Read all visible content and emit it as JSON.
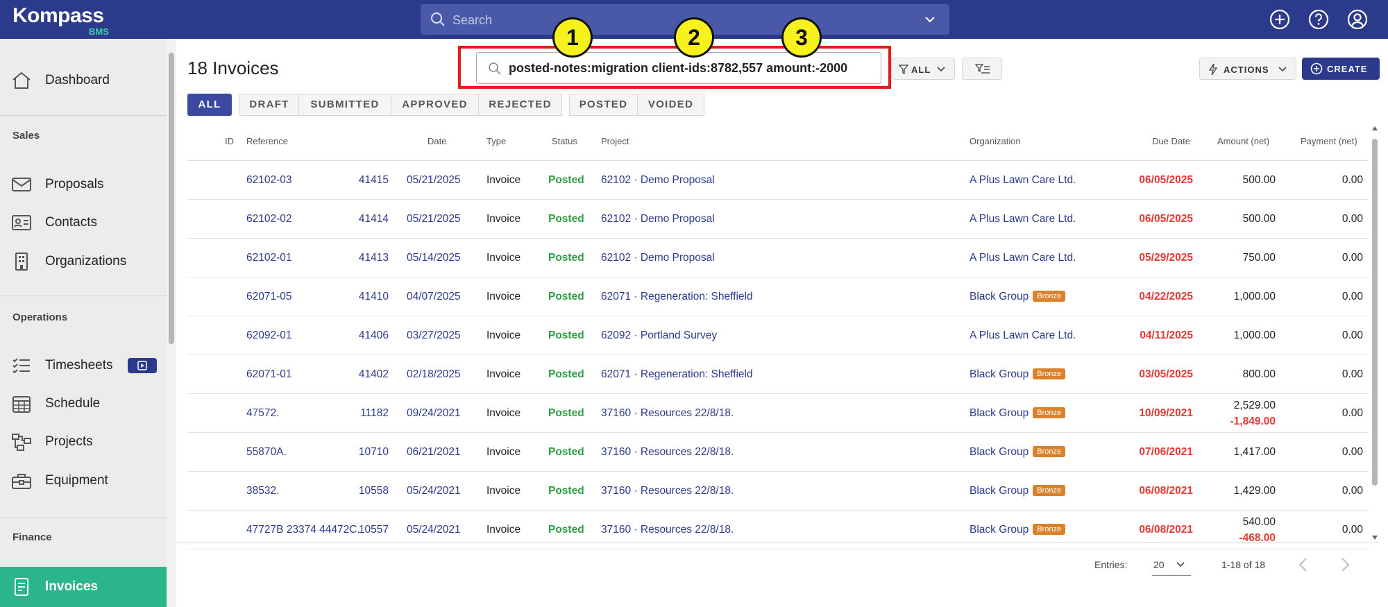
{
  "app": {
    "logo_name": "Kompass",
    "logo_sub": "BMS"
  },
  "topbar": {
    "search_placeholder": "Search"
  },
  "sidebar": {
    "items": [
      {
        "label": "Dashboard",
        "icon": "home-icon"
      },
      {
        "section": "Sales"
      },
      {
        "label": "Proposals",
        "icon": "envelope-icon"
      },
      {
        "label": "Contacts",
        "icon": "contact-card-icon"
      },
      {
        "label": "Organizations",
        "icon": "building-icon"
      },
      {
        "section": "Operations"
      },
      {
        "label": "Timesheets",
        "icon": "checklist-icon"
      },
      {
        "label": "Schedule",
        "icon": "calendar-icon"
      },
      {
        "label": "Projects",
        "icon": "project-tree-icon"
      },
      {
        "label": "Equipment",
        "icon": "toolbox-icon"
      },
      {
        "section": "Finance"
      },
      {
        "label": "Invoices",
        "icon": "invoice-icon",
        "active": true
      }
    ],
    "labels": {
      "dashboard": "Dashboard",
      "sales": "Sales",
      "proposals": "Proposals",
      "contacts": "Contacts",
      "organizations": "Organizations",
      "operations": "Operations",
      "timesheets": "Timesheets",
      "schedule": "Schedule",
      "projects": "Projects",
      "equipment": "Equipment",
      "finance": "Finance",
      "invoices": "Invoices"
    }
  },
  "main": {
    "title": "18 Invoices",
    "query": "posted-notes:migration client-ids:8782,557 amount:-2000",
    "markers": [
      "1",
      "2",
      "3"
    ],
    "filter_all": "ALL",
    "actions": "ACTIONS",
    "create": "CREATE",
    "tabs": [
      "ALL",
      "DRAFT",
      "SUBMITTED",
      "APPROVED",
      "REJECTED",
      "POSTED",
      "VOIDED"
    ]
  },
  "table": {
    "headers": {
      "id": "ID",
      "reference": "Reference",
      "date": "Date",
      "type": "Type",
      "status": "Status",
      "project": "Project",
      "organization": "Organization",
      "due": "Due Date",
      "amount": "Amount (net)",
      "payment": "Payment (net)"
    },
    "rows": [
      {
        "id": "41415",
        "ref": "62102-03",
        "date": "05/21/2025",
        "type": "Invoice",
        "status": "Posted",
        "project": "62102 · Demo Proposal",
        "org": "A Plus Lawn Care Ltd.",
        "badge": "",
        "due": "06/05/2025",
        "amount": "500.00",
        "amount2": "",
        "payment": "0.00"
      },
      {
        "id": "41414",
        "ref": "62102-02",
        "date": "05/21/2025",
        "type": "Invoice",
        "status": "Posted",
        "project": "62102 · Demo Proposal",
        "org": "A Plus Lawn Care Ltd.",
        "badge": "",
        "due": "06/05/2025",
        "amount": "500.00",
        "amount2": "",
        "payment": "0.00"
      },
      {
        "id": "41413",
        "ref": "62102-01",
        "date": "05/14/2025",
        "type": "Invoice",
        "status": "Posted",
        "project": "62102 · Demo Proposal",
        "org": "A Plus Lawn Care Ltd.",
        "badge": "",
        "due": "05/29/2025",
        "amount": "750.00",
        "amount2": "",
        "payment": "0.00"
      },
      {
        "id": "41410",
        "ref": "62071-05",
        "date": "04/07/2025",
        "type": "Invoice",
        "status": "Posted",
        "project": "62071 · Regeneration: Sheffield",
        "org": "Black Group",
        "badge": "Bronze",
        "due": "04/22/2025",
        "amount": "1,000.00",
        "amount2": "",
        "payment": "0.00"
      },
      {
        "id": "41406",
        "ref": "62092-01",
        "date": "03/27/2025",
        "type": "Invoice",
        "status": "Posted",
        "project": "62092 · Portland Survey",
        "org": "A Plus Lawn Care Ltd.",
        "badge": "",
        "due": "04/11/2025",
        "amount": "1,000.00",
        "amount2": "",
        "payment": "0.00"
      },
      {
        "id": "41402",
        "ref": "62071-01",
        "date": "02/18/2025",
        "type": "Invoice",
        "status": "Posted",
        "project": "62071 · Regeneration: Sheffield",
        "org": "Black Group",
        "badge": "Bronze",
        "due": "03/05/2025",
        "amount": "800.00",
        "amount2": "",
        "payment": "0.00"
      },
      {
        "id": "11182",
        "ref": "47572.",
        "date": "09/24/2021",
        "type": "Invoice",
        "status": "Posted",
        "project": "37160 · Resources 22/8/18.",
        "org": "Black Group",
        "badge": "Bronze",
        "due": "10/09/2021",
        "amount": "2,529.00",
        "amount2": "-1,849.00",
        "payment": "0.00"
      },
      {
        "id": "10710",
        "ref": "55870A.",
        "date": "06/21/2021",
        "type": "Invoice",
        "status": "Posted",
        "project": "37160 · Resources 22/8/18.",
        "org": "Black Group",
        "badge": "Bronze",
        "due": "07/06/2021",
        "amount": "1,417.00",
        "amount2": "",
        "payment": "0.00"
      },
      {
        "id": "10558",
        "ref": "38532.",
        "date": "05/24/2021",
        "type": "Invoice",
        "status": "Posted",
        "project": "37160 · Resources 22/8/18.",
        "org": "Black Group",
        "badge": "Bronze",
        "due": "06/08/2021",
        "amount": "1,429.00",
        "amount2": "",
        "payment": "0.00"
      },
      {
        "id": "10557",
        "ref": "47727B 23374 44472C.",
        "date": "05/24/2021",
        "type": "Invoice",
        "status": "Posted",
        "project": "37160 · Resources 22/8/18.",
        "org": "Black Group",
        "badge": "Bronze",
        "due": "06/08/2021",
        "amount": "540.00",
        "amount2": "-468.00",
        "payment": "0.00"
      }
    ]
  },
  "pager": {
    "entries_label": "Entries:",
    "entries_value": "20",
    "range": "1-18 of 18"
  },
  "colors": {
    "primary": "#2c3a8c",
    "accent": "#2bb58a",
    "posted": "#2e9e44",
    "due": "#e53935",
    "badge": "#d9822b"
  }
}
